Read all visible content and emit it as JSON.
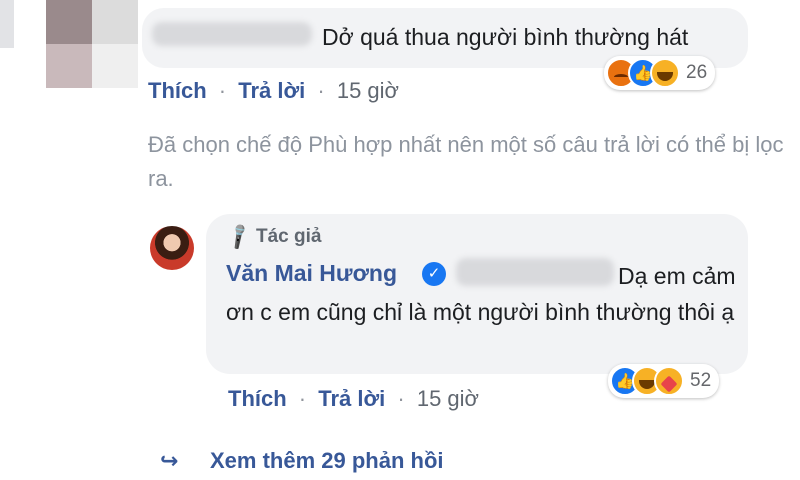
{
  "comment1": {
    "text": "Dở quá thua người bình thường hát",
    "reaction_count": "26",
    "reactions": [
      "angry-icon",
      "like-icon",
      "haha-icon"
    ]
  },
  "actions": {
    "like": "Thích",
    "reply": "Trả lời",
    "separator": "·"
  },
  "comment1_time": "15 giờ",
  "filter_note": "Đã chọn chế độ Phù hợp nhất nên một số câu trả lời có thể bị lọc ra.",
  "reply": {
    "badge": "Tác giả",
    "author": "Văn Mai Hương",
    "verified": "✓",
    "text": "Dạ em cảm ơn c em cũng chỉ là một người bình thường thôi ạ",
    "reaction_count": "52",
    "reactions": [
      "like-icon",
      "haha-icon",
      "care-icon"
    ],
    "time": "15 giờ"
  },
  "more_replies": "Xem thêm 29 phản hồi",
  "icons": {
    "mic": "🎤",
    "like": "👍",
    "reply_arrow": "↪"
  },
  "colors": {
    "link": "#385898",
    "bubble": "#f2f3f5",
    "like_blue": "#1877f2",
    "meta_gray": "#606770"
  }
}
